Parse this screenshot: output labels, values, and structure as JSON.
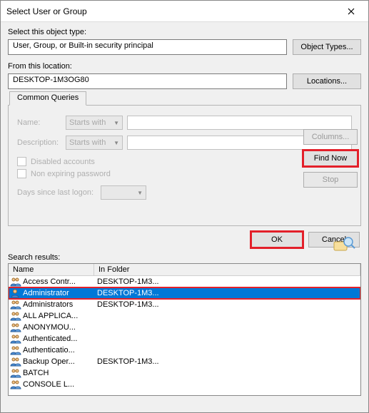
{
  "title": "Select User or Group",
  "labels": {
    "object_type": "Select this object type:",
    "location": "From this location:",
    "search_results": "Search results:"
  },
  "fields": {
    "object_type": "User, Group, or Built-in security principal",
    "location": "DESKTOP-1M3OG80"
  },
  "buttons": {
    "object_types": "Object Types...",
    "locations": "Locations...",
    "columns": "Columns...",
    "find_now": "Find Now",
    "stop": "Stop",
    "ok": "OK",
    "cancel": "Cancel"
  },
  "tabs": [
    "Common Queries"
  ],
  "query": {
    "name_label": "Name:",
    "desc_label": "Description:",
    "mode": "Starts with",
    "disabled_accounts": "Disabled accounts",
    "non_expiring": "Non expiring password",
    "days_label": "Days since last logon:"
  },
  "results": {
    "columns": [
      "Name",
      "In Folder"
    ],
    "rows": [
      {
        "icon": "group",
        "name": "Access Contr...",
        "folder": "DESKTOP-1M3...",
        "selected": false
      },
      {
        "icon": "user",
        "name": "Administrator",
        "folder": "DESKTOP-1M3...",
        "selected": true
      },
      {
        "icon": "group",
        "name": "Administrators",
        "folder": "DESKTOP-1M3...",
        "selected": false
      },
      {
        "icon": "group",
        "name": "ALL APPLICA...",
        "folder": "",
        "selected": false
      },
      {
        "icon": "group",
        "name": "ANONYMOU...",
        "folder": "",
        "selected": false
      },
      {
        "icon": "group",
        "name": "Authenticated...",
        "folder": "",
        "selected": false
      },
      {
        "icon": "group",
        "name": "Authenticatio...",
        "folder": "",
        "selected": false
      },
      {
        "icon": "group",
        "name": "Backup Oper...",
        "folder": "DESKTOP-1M3...",
        "selected": false
      },
      {
        "icon": "group",
        "name": "BATCH",
        "folder": "",
        "selected": false
      },
      {
        "icon": "group",
        "name": "CONSOLE L...",
        "folder": "",
        "selected": false
      }
    ]
  },
  "highlight_color": "#e3202a"
}
